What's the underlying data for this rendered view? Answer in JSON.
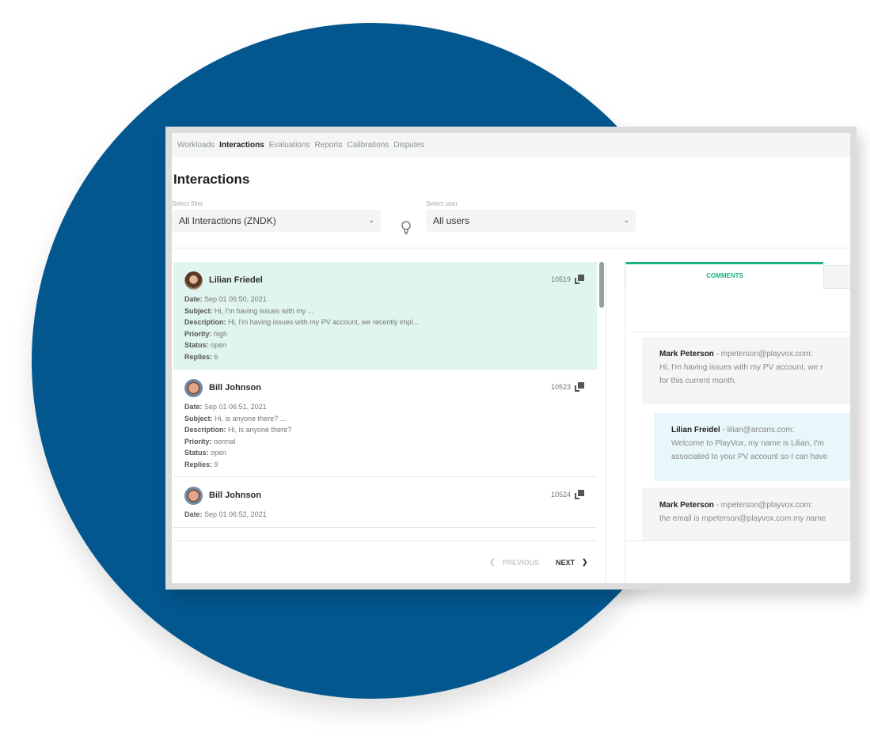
{
  "nav": {
    "items": [
      {
        "label": "Workloads",
        "active": false
      },
      {
        "label": "Interactions",
        "active": true
      },
      {
        "label": "Evaluations",
        "active": false
      },
      {
        "label": "Reports",
        "active": false
      },
      {
        "label": "Calibrations",
        "active": false
      },
      {
        "label": "Disputes",
        "active": false
      }
    ]
  },
  "page": {
    "title": "Interactions"
  },
  "filters": {
    "filter_label": "Select filter",
    "filter_value": "All Interactions (ZNDK)",
    "user_label": "Select user",
    "user_value": "All users"
  },
  "interactions": [
    {
      "name": "Lilian Friedel",
      "id": "10519",
      "selected": true,
      "date": "Sep 01 06:50, 2021",
      "subject": "Hi, I'm having issues with my ...",
      "description": "Hi, I'm having issues with my PV account, we recently impl...",
      "priority": "high",
      "status": "open",
      "replies": "6"
    },
    {
      "name": "Bill Johnson",
      "id": "10523",
      "selected": false,
      "date": "Sep 01 06:51, 2021",
      "subject": "Hi, is anyone there? ...",
      "description": "Hi, is anyone there?",
      "priority": "normal",
      "status": "open",
      "replies": "9"
    },
    {
      "name": "Bill Johnson",
      "id": "10524",
      "selected": false,
      "date": "Sep 01 06:52, 2021"
    }
  ],
  "labels": {
    "date": "Date:",
    "subject": "Subject:",
    "description": "Description:",
    "priority": "Priority:",
    "status": "Status:",
    "replies": "Replies:"
  },
  "pager": {
    "previous": "PREVIOUS",
    "next": "NEXT"
  },
  "tabs": {
    "comments": "COMMENTS"
  },
  "comments": [
    {
      "author": "Mark Peterson",
      "email": " - mpeterson@playvox.com:",
      "lines": [
        "Hi, I'm having issues with my PV account, we r",
        "for this current month."
      ]
    },
    {
      "author": "Lilian Freidel",
      "email": " - lilian@arcaris.com:",
      "lines": [
        "Welcome to PlayVox, my name is Lilian, I'm",
        "associated to your PV account so I can have"
      ]
    },
    {
      "author": "Mark Peterson",
      "email": " - mpeterson@playvox.com:",
      "lines": [
        "the email is mpeterson@playvox.com my name"
      ]
    }
  ],
  "colors": {
    "brand_blue": "#03578f",
    "accent_green": "#1ab77a",
    "selected_bg": "#e0f5ee"
  }
}
